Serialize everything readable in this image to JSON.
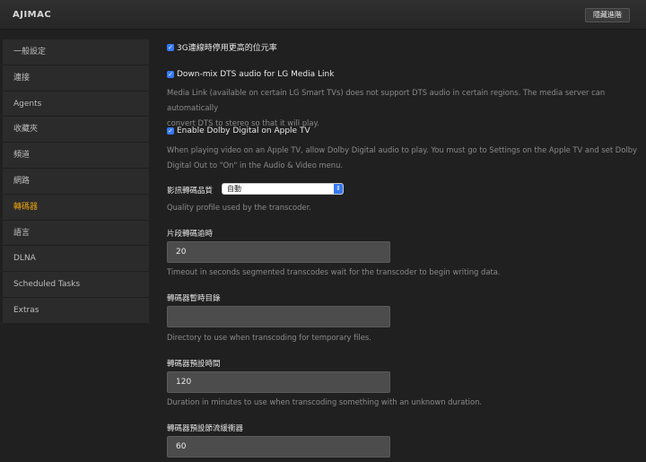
{
  "header": {
    "server_name": "AJIMAC",
    "hide_advanced_label": "隱藏進階"
  },
  "sidebar": {
    "items": [
      {
        "label": "一般設定"
      },
      {
        "label": "連接"
      },
      {
        "label": "Agents"
      },
      {
        "label": "收藏夾"
      },
      {
        "label": "頻道"
      },
      {
        "label": "網路"
      },
      {
        "label": "轉碼器",
        "active": true
      },
      {
        "label": "語言"
      },
      {
        "label": "DLNA"
      },
      {
        "label": "Scheduled Tasks"
      },
      {
        "label": "Extras"
      }
    ],
    "active_color": "#e5a00d"
  },
  "settings": {
    "disable_hq_3g": {
      "label": "3G連線時停用更高的位元率",
      "checked": true
    },
    "downmix_dts": {
      "label": "Down-mix DTS audio for LG Media Link",
      "checked": true,
      "help_line1": "Media Link (available on certain LG Smart TVs) does not support DTS audio in certain regions. The media server can automatically",
      "help_line2": "convert DTS to stereo so that it will play."
    },
    "dolby_apple_tv": {
      "label": "Enable Dolby Digital on Apple TV",
      "checked": true,
      "help_line1": "When playing video on an Apple TV, allow Dolby Digital audio to play. You must go to Settings on the Apple TV and set Dolby",
      "help_line2": "Digital Out to \"On\" in the Audio & Video menu."
    },
    "quality": {
      "label": "影訊轉碼品質",
      "value": "自動",
      "help": "Quality profile used by the transcoder."
    },
    "segment_timeout": {
      "label": "片段轉碼逾時",
      "value": "20",
      "help": "Timeout in seconds segmented transcodes wait for the transcoder to begin writing data."
    },
    "temp_dir": {
      "label": "轉碼器暫時目錄",
      "value": "",
      "help": "Directory to use when transcoding for temporary files."
    },
    "default_duration": {
      "label": "轉碼器預設時間",
      "value": "120",
      "help": "Duration in minutes to use when transcoding something with an unknown duration."
    },
    "throttle_buffer": {
      "label": "轉碼器預設節流緩衝器",
      "value": "60"
    }
  },
  "icons": {
    "checkbox": "checkmark-icon",
    "select": "select-arrows-icon"
  },
  "colors": {
    "accent": "#e5a00d",
    "checkbox": "#3478f6",
    "background": "#202020"
  }
}
